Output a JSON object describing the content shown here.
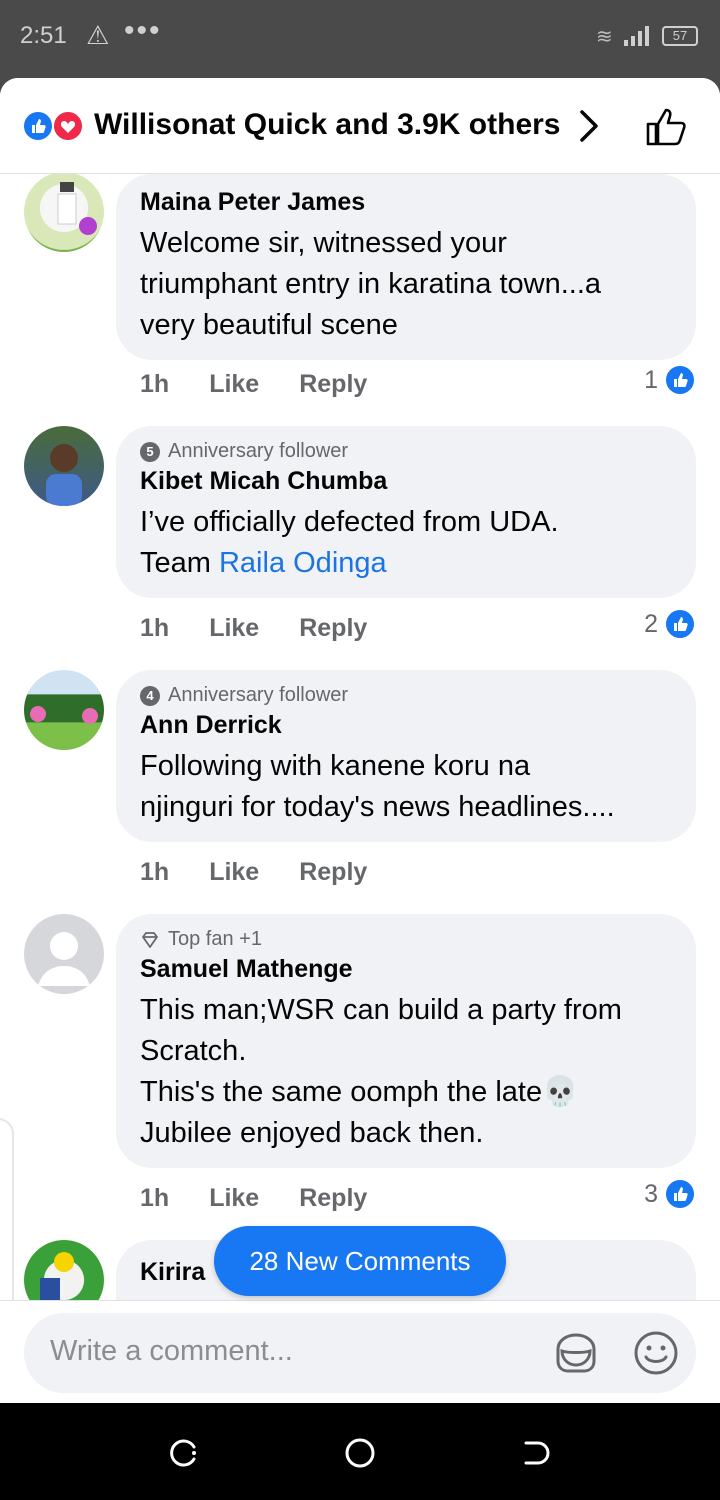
{
  "status_bar": {
    "time": "2:51",
    "battery": "57"
  },
  "header": {
    "reactions_summary": "Willisonat Quick and 3.9K others"
  },
  "comments": [
    {
      "author": "Maina Peter James",
      "badge": "",
      "text": "Welcome sir, witnessed your\ntriumphant entry in karatina town...a\nvery beautiful scene",
      "time": "1h",
      "like": "Like",
      "reply": "Reply",
      "likes": "1"
    },
    {
      "author": "Kibet Micah Chumba",
      "badge": "Anniversary follower",
      "badge_num": "5",
      "text": "I’ve officially defected from UDA.\nTeam ",
      "mention": "Raila Odinga",
      "time": "1h",
      "like": "Like",
      "reply": "Reply",
      "likes": "2"
    },
    {
      "author": "Ann Derrick",
      "badge": "Anniversary follower",
      "badge_num": "4",
      "text": "Following with kanene koru na\nnjinguri for today's news headlines....",
      "time": "1h",
      "like": "Like",
      "reply": "Reply",
      "likes": ""
    },
    {
      "author": "Samuel Mathenge",
      "badge": "Top fan +1",
      "text": "This man;WSR can build a party from\nScratch.\nThis's the same oomph the late💀\nJubilee enjoyed back then.",
      "time": "1h",
      "like": "Like",
      "reply": "Reply",
      "likes": "3"
    },
    {
      "author": "Kirira",
      "badge": "",
      "text": "",
      "time": "",
      "like": "",
      "reply": "",
      "likes": ""
    }
  ],
  "new_comments_label": "28 New Comments",
  "composer": {
    "placeholder": "Write a comment..."
  },
  "colors": {
    "accent": "#1877f2",
    "bubble": "#f0f2f5",
    "love": "#f0284a"
  }
}
